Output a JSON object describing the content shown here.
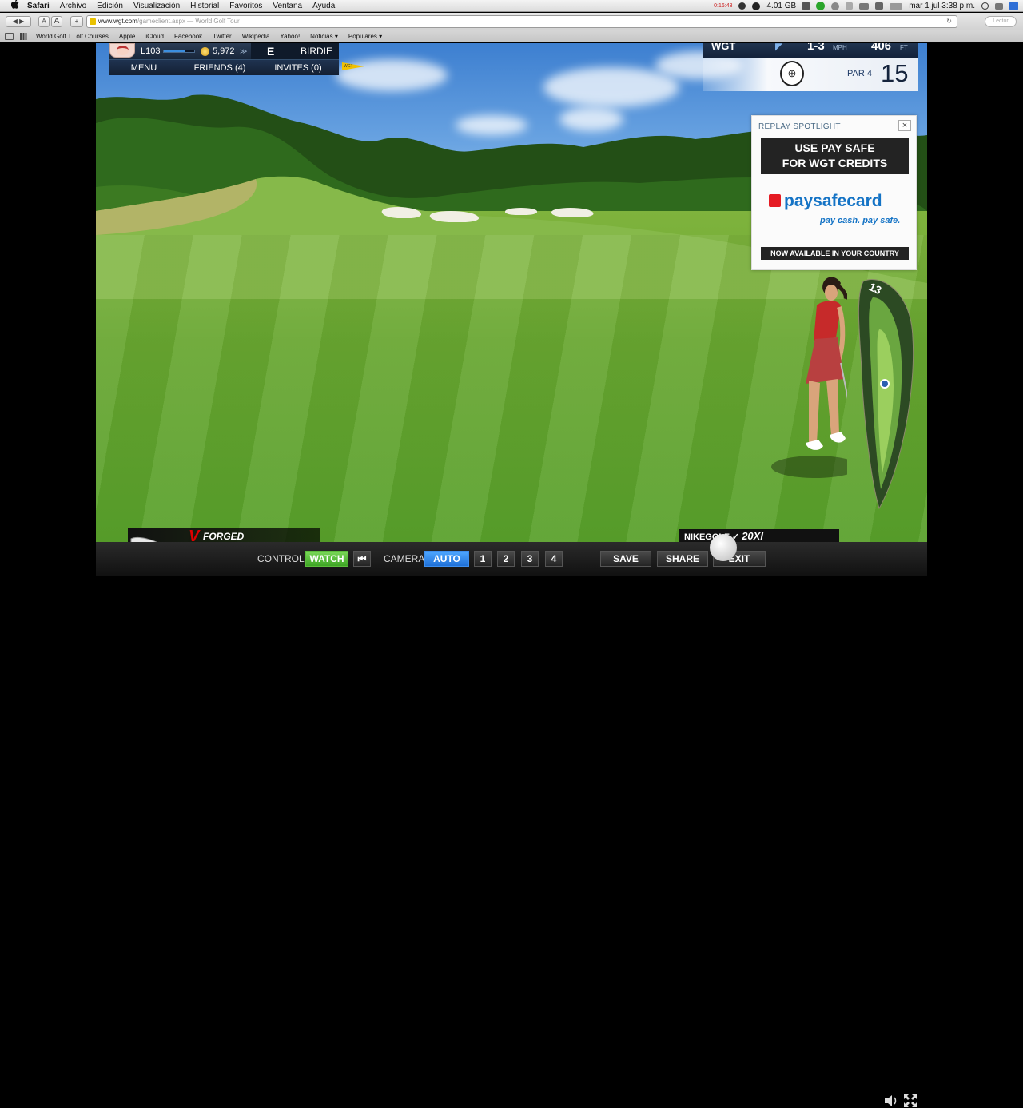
{
  "menubar": {
    "apple": "",
    "app_name": "Safari",
    "items": [
      "Archivo",
      "Edición",
      "Visualización",
      "Historial",
      "Favoritos",
      "Ventana",
      "Ayuda"
    ],
    "timer": "0:16:43",
    "disk": "4.01 GB",
    "datetime": "mar 1 jul  3:38 p.m."
  },
  "browser": {
    "url_host": "www.wgt.com",
    "url_path": "/gameclient.aspx",
    "page_title": "— World Golf Tour",
    "reader_label": "Lector",
    "btn_text_small": "A",
    "btn_text_large": "A"
  },
  "bookmarks": [
    "World Golf T...olf Courses",
    "Apple",
    "iCloud",
    "Facebook",
    "Twitter",
    "Wikipedia",
    "Yahoo!",
    "Noticias ▾",
    "Populares ▾"
  ],
  "hud": {
    "level": "L103",
    "level_progress": 0.7,
    "coins": "5,972",
    "score": "E",
    "shot_result": "BIRDIE",
    "menu_label": "MENU",
    "friends_label": "FRIENDS (4)",
    "invites_label": "INVITES (0)",
    "flag_label": "WGT"
  },
  "hole": {
    "brand": "WGT",
    "wind": "1-3",
    "wind_unit": "MPH",
    "distance": "406",
    "distance_unit": "FT",
    "par_label": "PAR 4",
    "number": "15"
  },
  "ad": {
    "title": "REPLAY SPOTLIGHT",
    "close": "×",
    "headline_1": "USE PAY SAFE",
    "headline_2": "FOR WGT CREDITS",
    "logo_text": "paysafecard",
    "tagline": "pay cash. pay safe.",
    "footer": "NOW AVAILABLE IN YOUR COUNTRY"
  },
  "branding": {
    "forged_v": "V",
    "forged_label": "FORGED",
    "nike_label": "NIKEGOLF",
    "nike_model": "20XI",
    "minimap_label": "13"
  },
  "controls": {
    "controls_label": "CONTROLS",
    "watch_label": "WATCH",
    "rewind_label": "⏮",
    "camera_label": "CAMERA",
    "auto_label": "AUTO",
    "cam_1": "1",
    "cam_2": "2",
    "cam_3": "3",
    "cam_4": "4",
    "save_label": "SAVE",
    "share_label": "SHARE",
    "exit_label": "EXIT"
  },
  "colors": {
    "accent_green": "#5bbd3b",
    "accent_blue": "#1f70d8",
    "hud_navy": "#18263a",
    "paysafe_red": "#e51b23",
    "paysafe_blue": "#1473c5"
  }
}
